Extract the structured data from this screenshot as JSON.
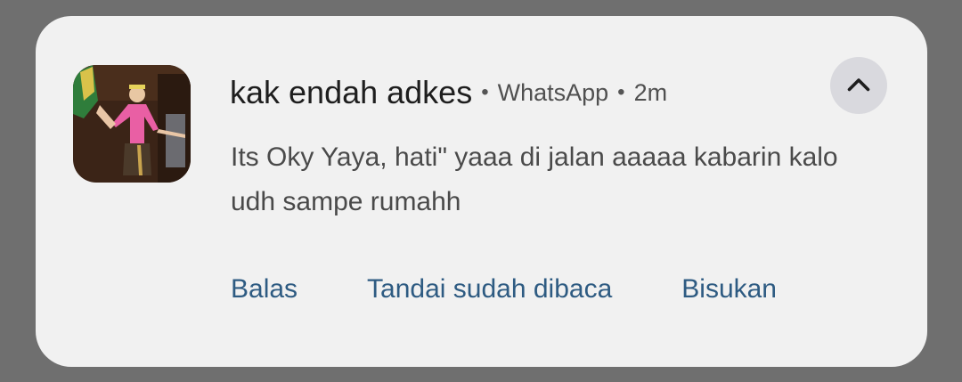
{
  "notification": {
    "sender": "kak endah adkes",
    "separator": "•",
    "app_name": "WhatsApp",
    "time": "2m",
    "message": "Its Oky Yaya, hati\" yaaa di jalan aaaaa kabarin kalo udh sampe rumahh",
    "avatar_icon": "contact-photo",
    "collapse_icon": "chevron-up-icon"
  },
  "actions": {
    "reply_label": "Balas",
    "mark_read_label": "Tandai sudah dibaca",
    "mute_label": "Bisukan"
  },
  "colors": {
    "background": "#6f6f6f",
    "card": "#f1f1f1",
    "action": "#2e5b82",
    "collapse_button": "#d9d9de"
  }
}
